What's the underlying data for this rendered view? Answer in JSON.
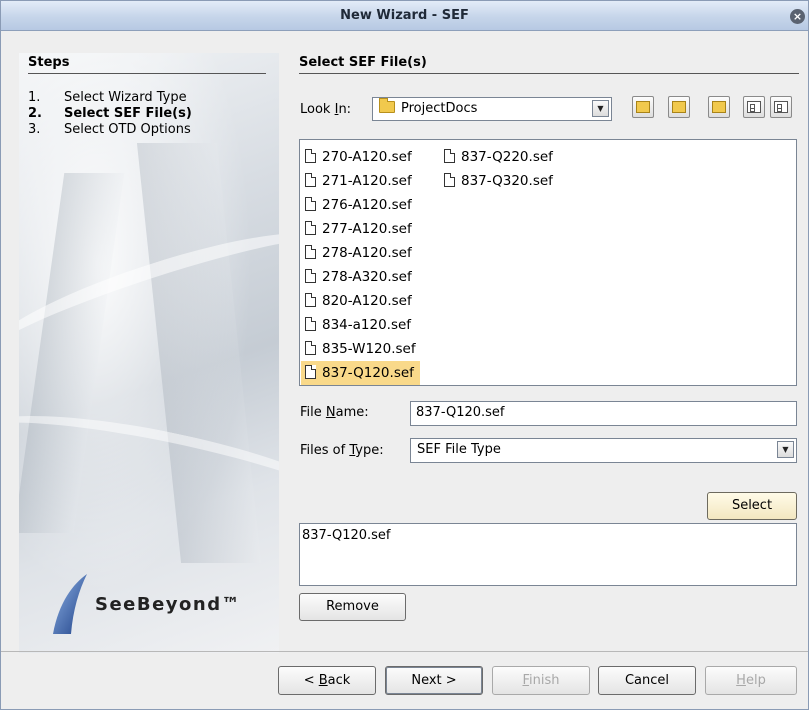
{
  "window": {
    "title": "New Wizard - SEF",
    "close_glyph": "×"
  },
  "steps": {
    "header": "Steps",
    "items": [
      {
        "num": "1.",
        "label": "Select Wizard Type",
        "active": false
      },
      {
        "num": "2.",
        "label": "Select SEF File(s)",
        "active": true
      },
      {
        "num": "3.",
        "label": "Select OTD Options",
        "active": false
      }
    ]
  },
  "logo": {
    "text": "SeeBeyond™"
  },
  "panel": {
    "title": "Select SEF File(s)",
    "look_in": {
      "label_pre": "Look ",
      "label_mnemonic": "I",
      "label_post": "n:",
      "value": "ProjectDocs"
    },
    "toolbar_icons": [
      "up-folder-icon",
      "home-icon",
      "new-folder-icon",
      "list-view-icon",
      "details-view-icon"
    ],
    "files_col1": [
      "270-A120.sef",
      "271-A120.sef",
      "276-A120.sef",
      "277-A120.sef",
      "278-A120.sef",
      "278-A320.sef",
      "820-A120.sef",
      "834-a120.sef",
      "835-W120.sef",
      "837-Q120.sef"
    ],
    "files_col2": [
      "837-Q220.sef",
      "837-Q320.sef"
    ],
    "selected_file": "837-Q120.sef",
    "file_name": {
      "label_pre": "File ",
      "label_mnemonic": "N",
      "label_post": "ame:",
      "value": "837-Q120.sef"
    },
    "files_of_type": {
      "label_pre": "Files of ",
      "label_mnemonic": "T",
      "label_post": "ype:",
      "value": "SEF File Type"
    },
    "select_button": "Select",
    "selected_list": [
      "837-Q120.sef"
    ],
    "remove_button": "Remove"
  },
  "footer": {
    "back_pre": "< ",
    "back_mnemonic": "B",
    "back_post": "ack",
    "next": "Next >",
    "finish_mnemonic": "F",
    "finish_post": "inish",
    "cancel": "Cancel",
    "help_mnemonic": "H",
    "help_post": "elp"
  },
  "colors": {
    "selection": "#f9d98a",
    "titlebar": "#c6d5ea",
    "folder": "#f1c94d"
  }
}
